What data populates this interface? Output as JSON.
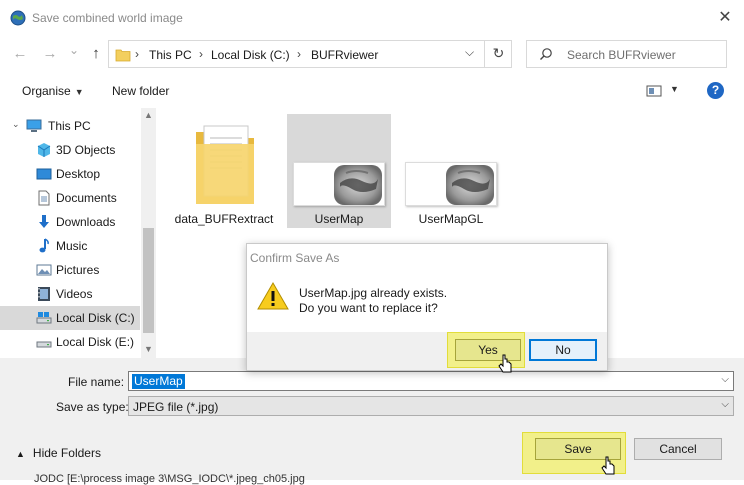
{
  "window": {
    "title": "Save combined world image",
    "close_glyph": "✕"
  },
  "nav": {
    "back_glyph": "←",
    "forward_glyph": "→",
    "recent_glyph": "⌄",
    "up_glyph": "↑",
    "breadcrumbs": [
      "This PC",
      "Local Disk (C:)",
      "BUFRviewer"
    ],
    "separator": "›",
    "refresh_glyph": "↻",
    "search_placeholder": "Search BUFRviewer"
  },
  "toolbar": {
    "organise": "Organise",
    "new_folder": "New folder",
    "caret": "▼",
    "help": "?"
  },
  "sidebar": {
    "items": [
      {
        "label": "This PC",
        "icon": "computer-icon"
      },
      {
        "label": "3D Objects",
        "icon": "cube-icon"
      },
      {
        "label": "Desktop",
        "icon": "desktop-icon"
      },
      {
        "label": "Documents",
        "icon": "document-icon"
      },
      {
        "label": "Downloads",
        "icon": "download-icon"
      },
      {
        "label": "Music",
        "icon": "music-icon"
      },
      {
        "label": "Pictures",
        "icon": "picture-icon"
      },
      {
        "label": "Videos",
        "icon": "video-icon"
      },
      {
        "label": "Local Disk (C:)",
        "icon": "drive-icon",
        "selected": true
      },
      {
        "label": "Local Disk (E:)",
        "icon": "drive-icon"
      }
    ],
    "scroll_up": "▲",
    "scroll_down": "▼"
  },
  "files": [
    {
      "name": "data_BUFRextract",
      "type": "folder"
    },
    {
      "name": "UserMap",
      "type": "image",
      "selected": true
    },
    {
      "name": "UserMapGL",
      "type": "image"
    }
  ],
  "form": {
    "file_name_label": "File name:",
    "file_name_value": "UserMap",
    "save_type_label": "Save as type:",
    "save_type_value": "JPEG file (*.jpg)",
    "dropdown_glyph": "⌵"
  },
  "footer": {
    "hide_folders": "Hide Folders",
    "hide_glyph": "▲",
    "save": "Save",
    "cancel": "Cancel",
    "truncated_text": "JODC   [E:\\process image 3\\MSG_IODC\\*.jpeg_ch05.jpg"
  },
  "dialog": {
    "title": "Confirm Save As",
    "line1": "UserMap.jpg already exists.",
    "line2": "Do you want to replace it?",
    "yes": "Yes",
    "no": "No"
  },
  "colors": {
    "accent": "#0078d7",
    "highlight": "#f2f08a",
    "selection": "#d9d9d9"
  }
}
